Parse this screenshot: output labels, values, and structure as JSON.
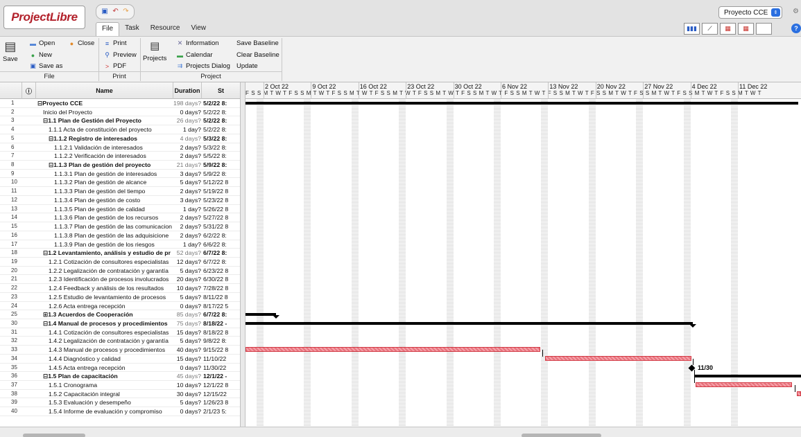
{
  "app": {
    "logo": "ProjectLibre",
    "logo_tm": "™"
  },
  "menu_tabs": [
    "File",
    "Task",
    "Resource",
    "View"
  ],
  "project_selector": "Proyecto CCE",
  "ribbon": {
    "file": {
      "open": "Open",
      "close": "Close",
      "new": "New",
      "save": "Save",
      "save_as": "Save as",
      "group": "File"
    },
    "print": {
      "print": "Print",
      "preview": "Preview",
      "pdf": "PDF",
      "group": "Print"
    },
    "project": {
      "projects": "Projects",
      "information": "Information",
      "calendar": "Calendar",
      "projects_dialog": "Projects Dialog",
      "save_baseline": "Save Baseline",
      "clear_baseline": "Clear Baseline",
      "update": "Update",
      "group": "Project"
    }
  },
  "table": {
    "headers": {
      "info": "ⓘ",
      "name": "Name",
      "duration": "Duration",
      "start": "St"
    },
    "rows": [
      {
        "id": "1",
        "name": "⊟Proyecto CCE",
        "duration": "198 days?",
        "start": "5/2/22 8:",
        "indent": 0,
        "summary": true
      },
      {
        "id": "2",
        "name": "Inicio del Proyecto",
        "duration": "0 days?",
        "start": "5/2/22 8:",
        "indent": 1,
        "summary": false
      },
      {
        "id": "3",
        "name": "⊟1.1  Plan de Gestión del Proyecto",
        "duration": "26 days?",
        "start": "5/2/22 8:",
        "indent": 1,
        "summary": true
      },
      {
        "id": "4",
        "name": "1.1.1  Acta de constitución del proyecto",
        "duration": "1 day?",
        "start": "5/2/22 8:",
        "indent": 2,
        "summary": false
      },
      {
        "id": "5",
        "name": "⊟1.1.2  Registro de interesados",
        "duration": "4 days?",
        "start": "5/3/22 8:",
        "indent": 2,
        "summary": true
      },
      {
        "id": "6",
        "name": "1.1.2.1  Validación de interesados",
        "duration": "2 days?",
        "start": "5/3/22 8:",
        "indent": 3,
        "summary": false
      },
      {
        "id": "7",
        "name": "1.1.2.2  Verificación de interesados",
        "duration": "2 days?",
        "start": "5/5/22 8:",
        "indent": 3,
        "summary": false
      },
      {
        "id": "8",
        "name": "⊟1.1.3  Plan de gestión del proyecto",
        "duration": "21 days?",
        "start": "5/9/22 8:",
        "indent": 2,
        "summary": true
      },
      {
        "id": "9",
        "name": "1.1.3.1  Plan de gestión de interesados",
        "duration": "3 days?",
        "start": "5/9/22 8:",
        "indent": 3,
        "summary": false
      },
      {
        "id": "10",
        "name": "1.1.3.2  Plan de gestión de alcance",
        "duration": "5 days?",
        "start": "5/12/22 8",
        "indent": 3,
        "summary": false
      },
      {
        "id": "11",
        "name": "1.1.3.3  Plan de gestión del tiempo",
        "duration": "2 days?",
        "start": "5/19/22 8",
        "indent": 3,
        "summary": false
      },
      {
        "id": "12",
        "name": "1.1.3.4  Plan de gestión de costo",
        "duration": "3 days?",
        "start": "5/23/22 8",
        "indent": 3,
        "summary": false
      },
      {
        "id": "13",
        "name": "1.1.3.5  Plan de gestión de calidad",
        "duration": "1 day?",
        "start": "5/26/22 8",
        "indent": 3,
        "summary": false
      },
      {
        "id": "14",
        "name": "1.1.3.6  Plan de gestión de los recursos",
        "duration": "2 days?",
        "start": "5/27/22 8",
        "indent": 3,
        "summary": false
      },
      {
        "id": "15",
        "name": "1.1.3.7  Plan de gestión de las comunicacion",
        "duration": "2 days?",
        "start": "5/31/22 8",
        "indent": 3,
        "summary": false
      },
      {
        "id": "16",
        "name": "1.1.3.8  Plan de gestión de las adquisicione",
        "duration": "2 days?",
        "start": "6/2/22 8:",
        "indent": 3,
        "summary": false
      },
      {
        "id": "17",
        "name": "1.1.3.9  Plan de gestión de los riesgos",
        "duration": "1 day?",
        "start": "6/6/22 8:",
        "indent": 3,
        "summary": false
      },
      {
        "id": "18",
        "name": "⊟1.2  Levantamiento, análisis y estudio de pr",
        "duration": "52 days?",
        "start": "6/7/22 8:",
        "indent": 1,
        "summary": true
      },
      {
        "id": "19",
        "name": "1.2.1  Cotización de consultores especialistas",
        "duration": "12 days?",
        "start": "6/7/22 8:",
        "indent": 2,
        "summary": false
      },
      {
        "id": "20",
        "name": "1.2.2  Legalización de contratación y garantía",
        "duration": "5 days?",
        "start": "6/23/22 8",
        "indent": 2,
        "summary": false
      },
      {
        "id": "21",
        "name": "1.2.3  Identificación de procesos involucrados",
        "duration": "20 days?",
        "start": "6/30/22 8",
        "indent": 2,
        "summary": false
      },
      {
        "id": "22",
        "name": "1.2.4  Feedback y análisis de los resultados",
        "duration": "10 days?",
        "start": "7/28/22 8",
        "indent": 2,
        "summary": false
      },
      {
        "id": "23",
        "name": "1.2.5  Estudio de levantamiento de procesos",
        "duration": "5 days?",
        "start": "8/11/22 8",
        "indent": 2,
        "summary": false
      },
      {
        "id": "24",
        "name": "1.2.6  Acta entrega recepción",
        "duration": "0 days?",
        "start": "8/17/22 5",
        "indent": 2,
        "summary": false
      },
      {
        "id": "25",
        "name": "⊞1.3  Acuerdos de Cooperación",
        "duration": "85 days?",
        "start": "6/7/22 8:",
        "indent": 1,
        "summary": true
      },
      {
        "id": "30",
        "name": "⊟1.4  Manual de procesos y procedimientos",
        "duration": "75 days?",
        "start": "8/18/22 -",
        "indent": 1,
        "summary": true
      },
      {
        "id": "31",
        "name": "1.4.1  Cotización de consultores especialistas",
        "duration": "15 days?",
        "start": "8/18/22 8",
        "indent": 2,
        "summary": false
      },
      {
        "id": "32",
        "name": "1.4.2  Legalización de contratación y garantía",
        "duration": "5 days?",
        "start": "9/8/22 8:",
        "indent": 2,
        "summary": false
      },
      {
        "id": "33",
        "name": "1.4.3  Manual de procesos y procedimientos",
        "duration": "40 days?",
        "start": "9/15/22 8",
        "indent": 2,
        "summary": false
      },
      {
        "id": "34",
        "name": "1.4.4  Diagnóstico y calidad",
        "duration": "15 days?",
        "start": "11/10/22",
        "indent": 2,
        "summary": false
      },
      {
        "id": "35",
        "name": "1.4.5  Acta entrega recepción",
        "duration": "0 days?",
        "start": "11/30/22",
        "indent": 2,
        "summary": false
      },
      {
        "id": "36",
        "name": "⊟1.5  Plan de capacitación",
        "duration": "45 days?",
        "start": "12/1/22 -",
        "indent": 1,
        "summary": true
      },
      {
        "id": "37",
        "name": "1.5.1  Cronograma",
        "duration": "10 days?",
        "start": "12/1/22 8",
        "indent": 2,
        "summary": false
      },
      {
        "id": "38",
        "name": "1.5.2  Capacitación integral",
        "duration": "30 days?",
        "start": "12/15/22",
        "indent": 2,
        "summary": false
      },
      {
        "id": "39",
        "name": "1.5.3  Evaluación y desempeño",
        "duration": "5 days?",
        "start": "1/26/23 8",
        "indent": 2,
        "summary": false
      },
      {
        "id": "40",
        "name": "1.5.4  Informe de evaluación y compromiso",
        "duration": "0 days?",
        "start": "2/1/23 5:",
        "indent": 2,
        "summary": false
      }
    ]
  },
  "gantt": {
    "weeks": [
      "2 Oct 22",
      "9 Oct 22",
      "16 Oct 22",
      "23 Oct 22",
      "30 Oct 22",
      "6 Nov 22",
      "13 Nov 22",
      "20 Nov 22",
      "27 Nov 22",
      "4 Dec 22",
      "11 Dec 22"
    ],
    "day_letters": "F S S M T W T F S S M T W T F S S M T W T F S S M T W T F S S M T W T F S S M T W T F S S M T W T F S S M T W T F S S M T W T F S S M T W T F S S M T W T F S S M T W T",
    "milestone_label": "11/30"
  }
}
